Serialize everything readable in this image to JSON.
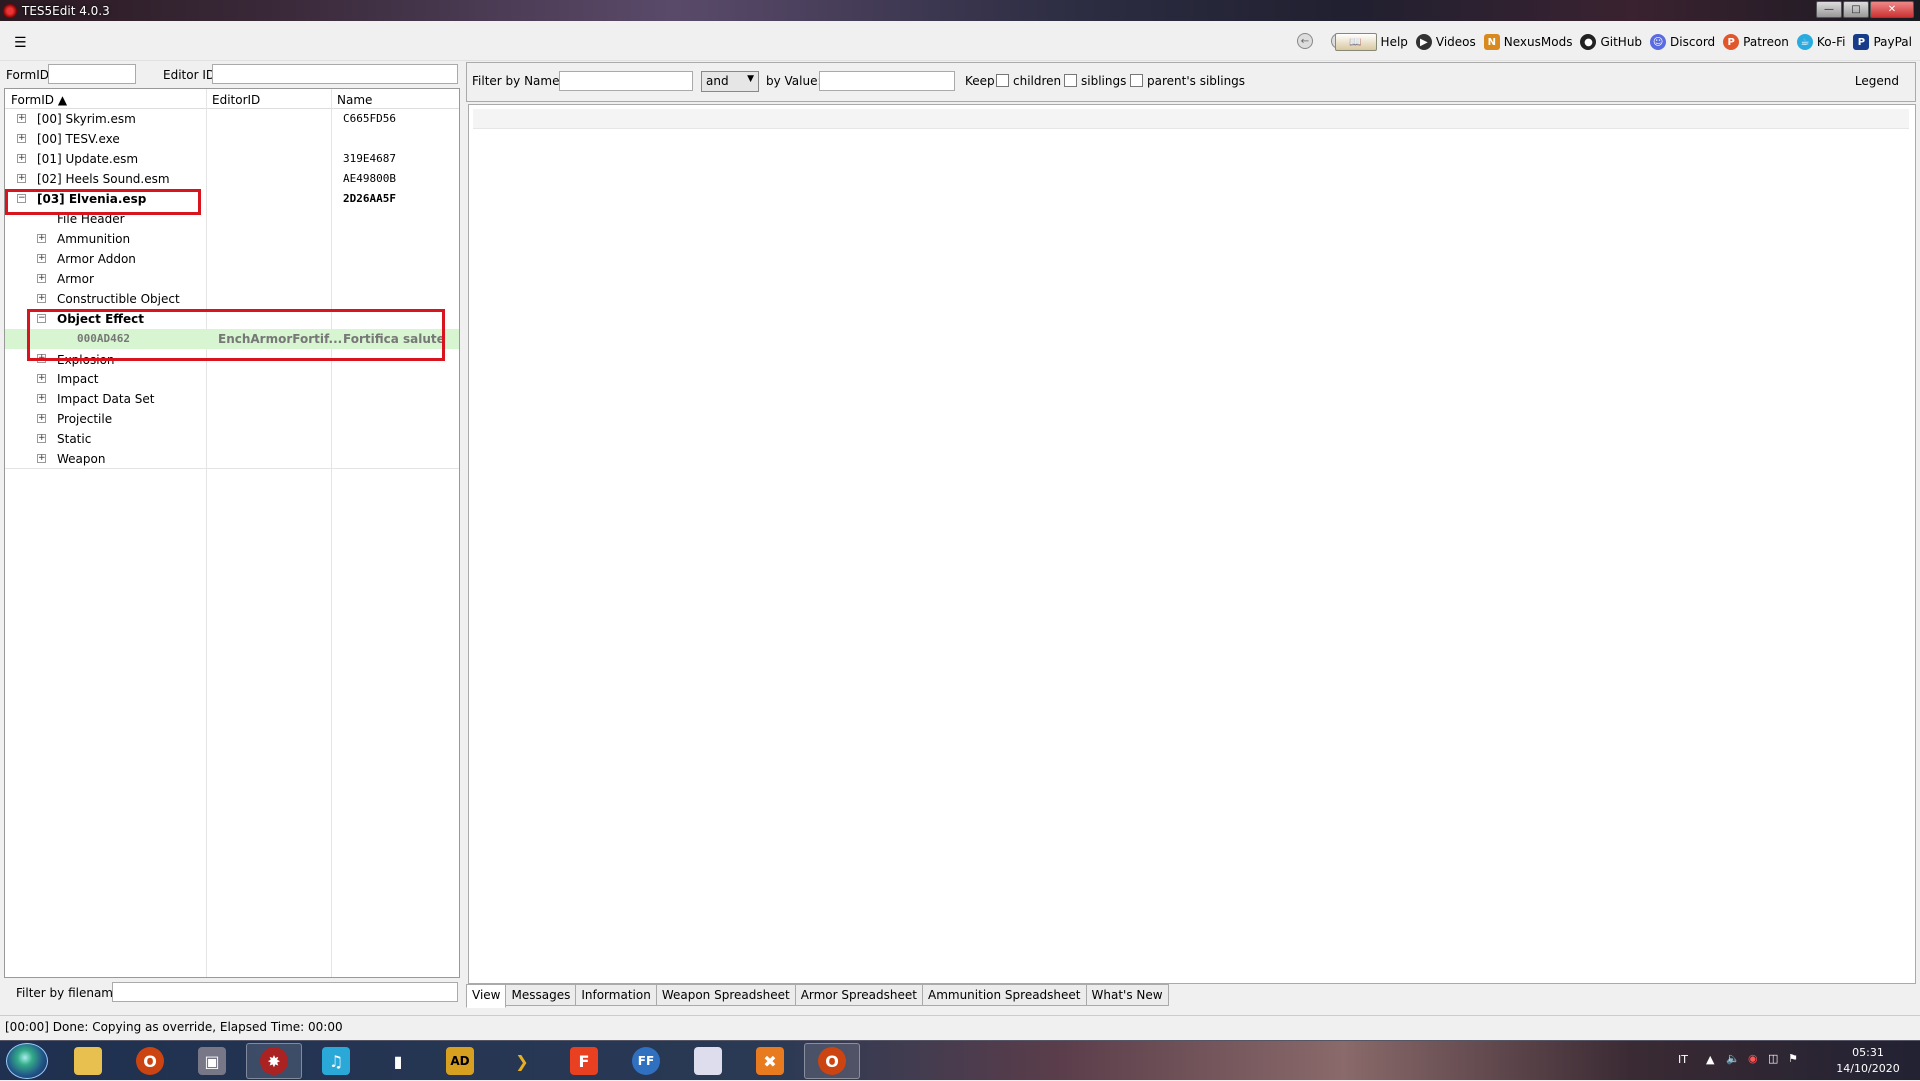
{
  "window": {
    "title": "TES5Edit 4.0.3"
  },
  "toolbar": {
    "links": [
      {
        "label": "Help",
        "icon": "book-icon"
      },
      {
        "label": "Videos",
        "icon": "videos-icon"
      },
      {
        "label": "NexusMods",
        "icon": "nexusmods-icon"
      },
      {
        "label": "GitHub",
        "icon": "github-icon"
      },
      {
        "label": "Discord",
        "icon": "discord-icon"
      },
      {
        "label": "Patreon",
        "icon": "patreon-icon"
      },
      {
        "label": "Ko-Fi",
        "icon": "kofi-icon"
      },
      {
        "label": "PayPal",
        "icon": "paypal-icon"
      }
    ]
  },
  "left": {
    "formid_label": "FormID",
    "editorid_label": "Editor ID",
    "columns": {
      "formid": "FormID",
      "editorid": "EditorID",
      "name": "Name"
    },
    "rows": [
      {
        "label": "[00] Skyrim.esm",
        "name": "C665FD56"
      },
      {
        "label": "[00] TESV.exe",
        "name": ""
      },
      {
        "label": "[01] Update.esm",
        "name": "319E4687"
      },
      {
        "label": "[02] Heels Sound.esm",
        "name": "AE49800B"
      },
      {
        "label": "[03] Elvenia.esp",
        "name": "2D26AA5F"
      },
      {
        "label": "File Header"
      },
      {
        "label": "Ammunition"
      },
      {
        "label": "Armor Addon"
      },
      {
        "label": "Armor"
      },
      {
        "label": "Constructible Object"
      },
      {
        "label": "Object Effect"
      },
      {
        "label": "000AD462",
        "editorid": "EnchArmorFortif...",
        "name": "Fortifica salute"
      },
      {
        "label": "Explosion"
      },
      {
        "label": "Impact"
      },
      {
        "label": "Impact Data Set"
      },
      {
        "label": "Projectile"
      },
      {
        "label": "Static"
      },
      {
        "label": "Weapon"
      }
    ],
    "filter_filename_label": "Filter by filename:"
  },
  "right": {
    "filter_by_name_label": "Filter by Name:",
    "combo_value": "and",
    "by_value_label": "by Value:",
    "keep_label": "Keep",
    "children_label": "children",
    "siblings_label": "siblings",
    "parents_siblings_label": "parent's siblings",
    "legend_label": "Legend",
    "tabs": [
      "View",
      "Messages",
      "Information",
      "Weapon Spreadsheet",
      "Armor Spreadsheet",
      "Ammunition Spreadsheet",
      "What's New"
    ]
  },
  "status": {
    "text": "[00:00] Done: Copying as override, Elapsed Time: 00:00"
  },
  "taskbar": {
    "lang": "IT",
    "time": "05:31",
    "date": "14/10/2020"
  }
}
